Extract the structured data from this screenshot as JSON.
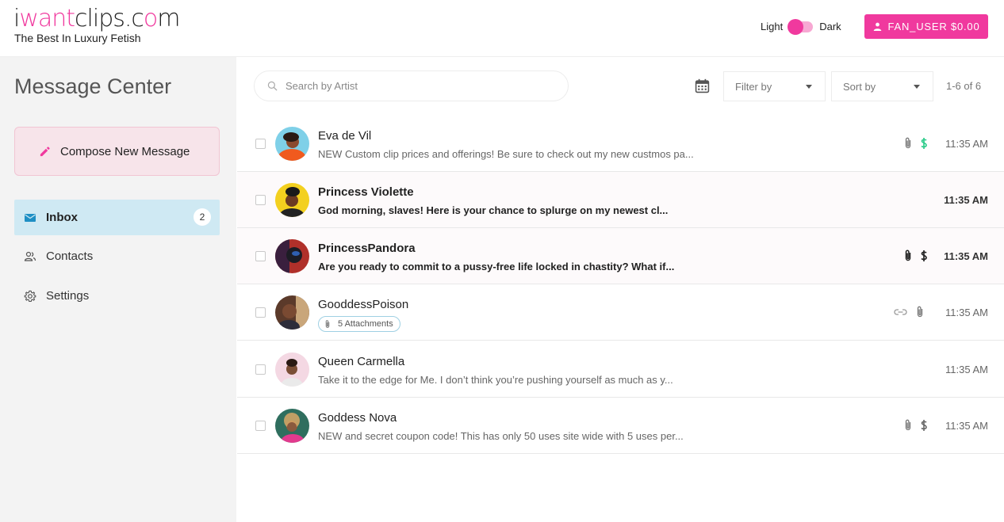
{
  "header": {
    "logo_i": "i",
    "logo_want": "want",
    "logo_clips": "clips.c",
    "logo_o": "o",
    "logo_m": "m",
    "tagline": "The Best In Luxury Fetish",
    "theme_light": "Light",
    "theme_dark": "Dark",
    "user_label": "FAN_USER $0.00"
  },
  "sidebar": {
    "title": "Message Center",
    "compose_label": "Compose New Message",
    "inbox_label": "Inbox",
    "inbox_count": "2",
    "contacts_label": "Contacts",
    "settings_label": "Settings"
  },
  "toolbar": {
    "search_placeholder": "Search by Artist",
    "filter_label": "Filter by",
    "sort_label": "Sort by",
    "range": "1-6 of 6"
  },
  "messages": [
    {
      "sender": "Eva de Vil",
      "preview": "NEW Custom clip prices and offerings! Be sure to check out my new custmos pa...",
      "time": "11:35 AM"
    },
    {
      "sender": "Princess Violette",
      "preview": "God morning, slaves! Here is your chance to splurge on my newest cl...",
      "time": "11:35 AM"
    },
    {
      "sender": "PrincessPandora",
      "preview": "Are you ready to commit to a pussy-free life locked in chastity? What if...",
      "time": "11:35 AM"
    },
    {
      "sender": "GooddessPoison",
      "attachments": "5 Attachments",
      "time": "11:35 AM"
    },
    {
      "sender": "Queen Carmella",
      "preview": "Take it to the edge for Me. I don’t think you’re pushing yourself as much as y...",
      "time": "11:35 AM"
    },
    {
      "sender": "Goddess Nova",
      "preview": "NEW and secret coupon code! This has only 50 uses site wide with 5 uses per...",
      "time": "11:35 AM"
    }
  ],
  "colors": {
    "brand_pink": "#f0399e",
    "inbox_active": "#cfe9f3",
    "compose_bg": "#f7e4ea",
    "dollar_green": "#2ecc8b"
  }
}
